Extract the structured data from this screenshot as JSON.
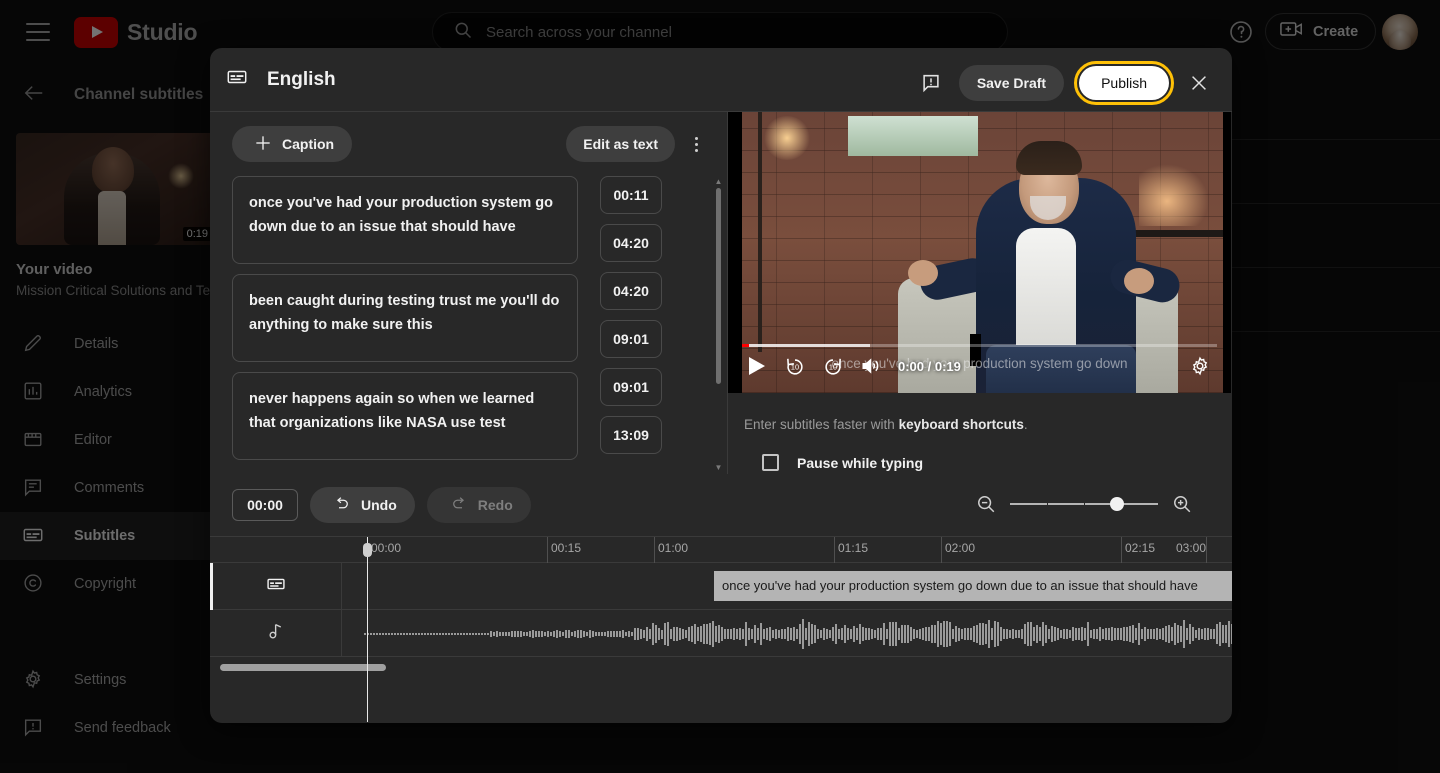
{
  "topbar": {
    "menu_icon": "hamburger-icon",
    "brand": "Studio",
    "search": {
      "placeholder": "Search across your channel",
      "value": "",
      "icon": "search-icon"
    },
    "help_icon": "help-circle-icon",
    "create_label": "Create",
    "create_icon": "create-video-icon",
    "avatar": "user-avatar"
  },
  "sidebar": {
    "back_label": "Channel subtitles",
    "back_icon": "arrow-left-icon",
    "video_duration": "0:19",
    "video_title": "Your video",
    "video_subtitle": "Mission Critical Solutions and Tes",
    "items": [
      {
        "label": "Details",
        "icon": "pencil-icon",
        "active": false
      },
      {
        "label": "Analytics",
        "icon": "bar-chart-icon",
        "active": false
      },
      {
        "label": "Editor",
        "icon": "clapperboard-icon",
        "active": false
      },
      {
        "label": "Comments",
        "icon": "comment-icon",
        "active": false
      },
      {
        "label": "Subtitles",
        "icon": "subtitles-icon",
        "active": true
      },
      {
        "label": "Copyright",
        "icon": "copyright-icon",
        "active": false
      }
    ],
    "footer_items": [
      {
        "label": "Settings",
        "icon": "gear-icon"
      },
      {
        "label": "Send feedback",
        "icon": "feedback-icon"
      }
    ]
  },
  "modal": {
    "title": "English",
    "title_icon": "subtitles-icon",
    "flag_icon": "report-flag-icon",
    "save_draft_label": "Save Draft",
    "publish_label": "Publish",
    "publish_focus_color": "#ffc107",
    "close_icon": "close-icon",
    "toolbar": {
      "add_caption_label": "Caption",
      "add_caption_icon": "plus-icon",
      "edit_as_text_label": "Edit as text",
      "more_options_icon": "kebab-menu-icon"
    },
    "captions": [
      {
        "text": "once you've had your production system go down due to an issue that should have"
      },
      {
        "text": "been caught during testing trust me you'll do anything to make sure this"
      },
      {
        "text": "never happens again so when we learned that organizations like NASA use test"
      }
    ],
    "timestamps": [
      "00:11",
      "04:20",
      "04:20",
      "09:01",
      "09:01",
      "13:09"
    ],
    "player": {
      "play_icon": "play-icon",
      "rewind_label": "10",
      "rewind_icon": "replay-10-icon",
      "forward_label": "10",
      "forward_icon": "forward-10-icon",
      "volume_icon": "volume-icon",
      "current_time": "0:00",
      "duration": "0:19",
      "time_display": "0:00 / 0:19",
      "settings_icon": "gear-icon",
      "subtitle_overlay": "once you've had your production system go down"
    },
    "hint_prefix": "Enter subtitles faster with ",
    "hint_link": "keyboard shortcuts",
    "hint_suffix": ".",
    "pause_while_typing_label": "Pause while typing",
    "pause_while_typing_checked": false,
    "timeline_toolbar": {
      "current_time": "00:00",
      "undo_label": "Undo",
      "undo_icon": "undo-icon",
      "redo_label": "Redo",
      "redo_icon": "redo-icon",
      "redo_disabled": true,
      "zoom_out_icon": "zoom-out-icon",
      "zoom_in_icon": "zoom-in-icon",
      "zoom_value": 68
    },
    "timeline": {
      "ruler_labels": [
        "00:00",
        "00:15",
        "01:00",
        "01:15",
        "02:00",
        "02:15",
        "03:00"
      ],
      "subtitle_track_icon": "subtitles-icon",
      "audio_track_icon": "music-note-icon",
      "segment_text": "once you've had your production system  go down due to an issue that should have"
    }
  }
}
